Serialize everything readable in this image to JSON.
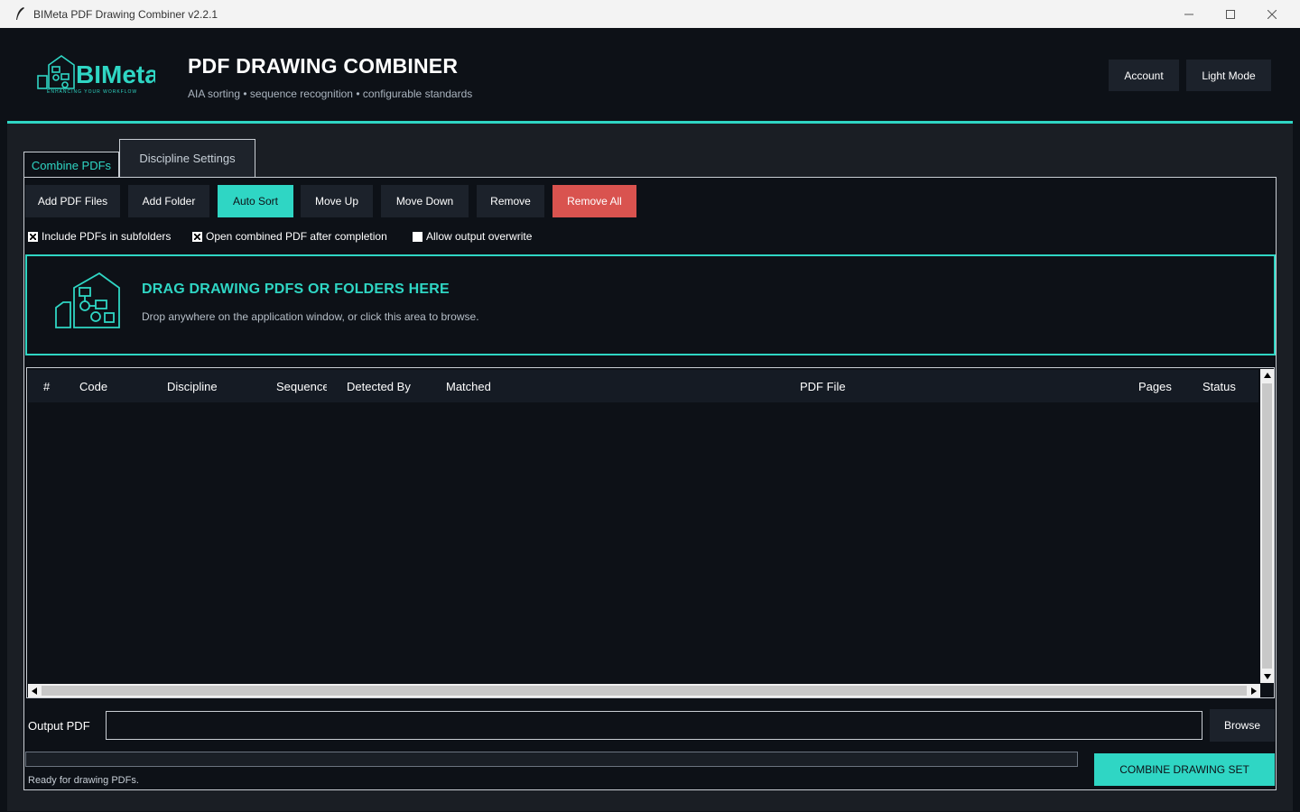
{
  "window": {
    "title": "BIMeta PDF Drawing Combiner v2.2.1"
  },
  "header": {
    "logo_text": "BIMeta",
    "logo_tagline": "ENHANCING YOUR WORKFLOW",
    "title": "PDF DRAWING COMBINER",
    "subtitle": "AIA sorting • sequence recognition • configurable standards",
    "account_label": "Account",
    "theme_label": "Light Mode"
  },
  "tabs": [
    {
      "label": "Combine PDFs",
      "active": true
    },
    {
      "label": "Discipline Settings",
      "active": false
    }
  ],
  "toolbar": {
    "add_files": "Add PDF Files",
    "add_folder": "Add Folder",
    "auto_sort": "Auto Sort",
    "move_up": "Move Up",
    "move_down": "Move Down",
    "remove": "Remove",
    "remove_all": "Remove All"
  },
  "options": {
    "subfolders": {
      "label": "Include PDFs in subfolders",
      "checked": true
    },
    "open_after": {
      "label": "Open combined PDF after completion",
      "checked": true
    },
    "overwrite": {
      "label": "Allow output overwrite",
      "checked": false
    }
  },
  "dropzone": {
    "title": "DRAG DRAWING PDFS OR FOLDERS HERE",
    "subtitle": "Drop anywhere on the application window, or click this area to browse."
  },
  "table": {
    "columns": [
      "#",
      "Code",
      "Discipline",
      "Sequence",
      "Detected By",
      "Matched",
      "PDF File",
      "Pages",
      "Status"
    ],
    "rows": []
  },
  "output": {
    "label": "Output PDF",
    "value": "",
    "browse_label": "Browse"
  },
  "progress": {
    "value": 0
  },
  "status": "Ready for drawing PDFs.",
  "combine_label": "COMBINE DRAWING SET",
  "colors": {
    "accent": "#2fd6c4",
    "danger": "#d9534f",
    "background": "#0d1117"
  }
}
